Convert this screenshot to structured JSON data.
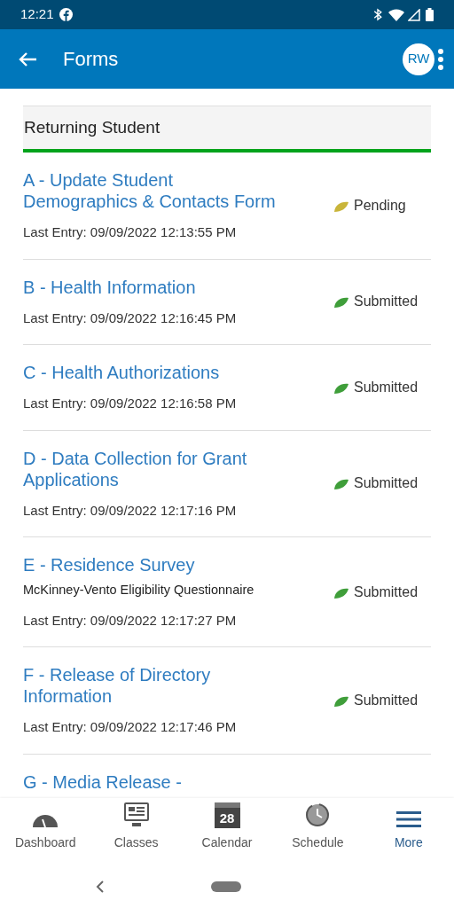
{
  "status_bar": {
    "time": "12:21"
  },
  "app_bar": {
    "title": "Forms",
    "avatar": "RW"
  },
  "section": {
    "title": "Returning Student"
  },
  "forms": [
    {
      "title": "A - Update Student Demographics & Contacts Form",
      "last_entry": "Last Entry: 09/09/2022 12:13:55 PM",
      "status": "Pending",
      "kind": "pending"
    },
    {
      "title": "B - Health Information",
      "last_entry": "Last Entry: 09/09/2022 12:16:45 PM",
      "status": "Submitted",
      "kind": "submitted"
    },
    {
      "title": "C - Health Authorizations",
      "last_entry": "Last Entry: 09/09/2022 12:16:58 PM",
      "status": "Submitted",
      "kind": "submitted"
    },
    {
      "title": "D - Data Collection for Grant Applications",
      "last_entry": "Last Entry: 09/09/2022 12:17:16 PM",
      "status": "Submitted",
      "kind": "submitted"
    },
    {
      "title": "E - Residence Survey",
      "subtitle": "McKinney-Vento Eligibility Questionnaire",
      "last_entry": "Last Entry: 09/09/2022 12:17:27 PM",
      "status": "Submitted",
      "kind": "submitted"
    },
    {
      "title": "F - Release of Directory Information",
      "last_entry": "Last Entry: 09/09/2022 12:17:46 PM",
      "status": "Submitted",
      "kind": "submitted"
    },
    {
      "title": "G - Media Release -"
    }
  ],
  "bottom_nav": [
    {
      "label": "Dashboard",
      "kind": "gauge",
      "selected": false
    },
    {
      "label": "Classes",
      "kind": "monitor",
      "selected": false
    },
    {
      "label": "Calendar",
      "kind": "calendar",
      "day": "28",
      "selected": false
    },
    {
      "label": "Schedule",
      "kind": "clock",
      "selected": false
    },
    {
      "label": "More",
      "kind": "menu",
      "selected": true
    }
  ]
}
